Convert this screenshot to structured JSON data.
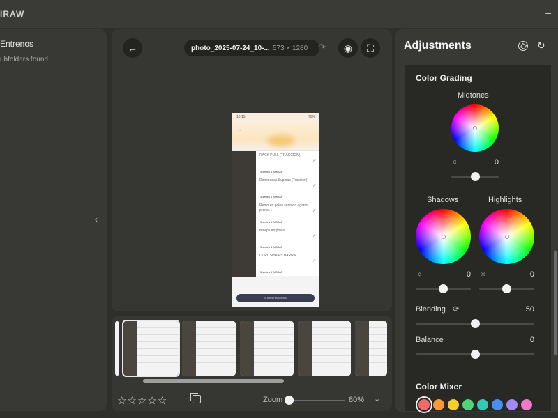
{
  "app": {
    "name": "IRAW"
  },
  "window": {
    "minimize_glyph": "–"
  },
  "left_panel": {
    "folder_title": "Entrenos",
    "subfolders_text": "ubfolders found.",
    "collapse_glyph": "‹"
  },
  "viewer": {
    "back_glyph": "←",
    "filename": "photo_2025-07-24_10-...",
    "dimensions": "573 × 1280",
    "redo_glyph": "↷",
    "eye_glyph": "◉",
    "fullscreen_glyph": "⛶"
  },
  "phone": {
    "status_time": "10:15",
    "status_battery": "75%",
    "rows": [
      {
        "title": "RACK PULL (TRACCIÓN)",
        "meta": "4 series  1 AMRAP"
      },
      {
        "title": "Dominadas Supinas (Tracción)",
        "meta": "3 series  1 AMRAP"
      },
      {
        "title": "Remo en polea sentado agarre prono ...",
        "meta": "3 series  1 AMRAP"
      },
      {
        "title": "Bíceps en polea",
        "meta": "3 series  1 AMRAP"
      },
      {
        "title": "CURL SHRIPS BARRA ...",
        "meta": "3 series  1 AMRAP"
      }
    ],
    "bottom_button": "Ir a tus resultados"
  },
  "filmstrip": {
    "thumb_count": 5
  },
  "bottom_bar": {
    "stars": "☆☆☆☆☆",
    "zoom_label": "Zoom",
    "zoom_percent": 80,
    "zoom_value": "80%",
    "zoom_chevron": "⌄"
  },
  "adjustments": {
    "title": "Adjustments",
    "reset_glyph": "↻",
    "color_grading": {
      "title": "Color Grading",
      "midtones": {
        "label": "Midtones",
        "value": "0",
        "slider": 0.5
      },
      "shadows": {
        "label": "Shadows",
        "value": "0",
        "slider": 0.5
      },
      "highlights": {
        "label": "Highlights",
        "value": "0",
        "slider": 0.5
      },
      "blending": {
        "label": "Blending",
        "value": "50",
        "slider": 0.5
      },
      "balance": {
        "label": "Balance",
        "value": "0",
        "slider": 0.5
      },
      "sun_glyph": "☼",
      "sync_glyph": "⟳"
    },
    "color_mixer": {
      "title": "Color Mixer",
      "swatches": [
        "#f06a6a",
        "#f59a3c",
        "#f2cf2c",
        "#4fd37a",
        "#33c9b4",
        "#4b8df0",
        "#a08af0",
        "#f07ac8"
      ]
    }
  }
}
